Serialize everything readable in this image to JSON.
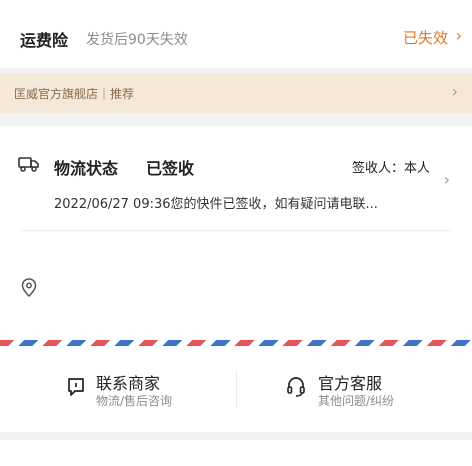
{
  "insurance": {
    "label": "运费险",
    "desc": "发货后90天失效",
    "status": "已失效",
    "status_color": "#e0782c"
  },
  "store_bar": {
    "name": "匡威官方旗舰店｜推荐"
  },
  "logistics": {
    "title": "物流状态",
    "state": "已签收",
    "receiver": "签收人：本人",
    "detail": "2022/06/27 09:36您的快件已签收，如有疑问请电联..."
  },
  "actions": {
    "contact": {
      "title": "联系商家",
      "sub": "物流/售后咨询"
    },
    "service": {
      "title": "官方客服",
      "sub": "其他问题/纠纷"
    }
  },
  "icons": {
    "truck": "truck-icon",
    "pin": "location-pin-icon",
    "chat": "chat-icon",
    "headset": "headset-icon",
    "chevron": "chevron-right-icon"
  }
}
